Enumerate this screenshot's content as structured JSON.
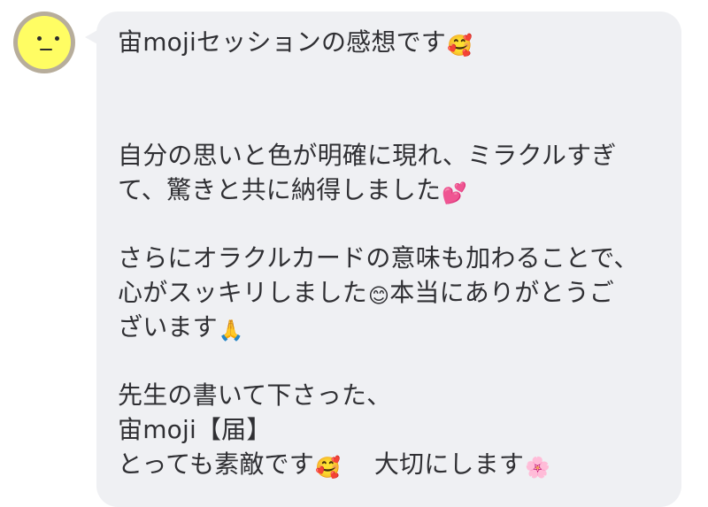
{
  "message": {
    "title": "宙mojiセッションの感想です",
    "title_emoji": "🥰",
    "paragraph1_line1": "自分の思いと色が明確に現れ、ミラクルすぎ",
    "paragraph1_line2": "て、驚きと共に納得しました",
    "paragraph1_emoji": "💕",
    "paragraph2_line1": "さらにオラクルカードの意味も加わることで、",
    "paragraph2_line2a": "心がスッキリしました",
    "paragraph2_emoji": "😊",
    "paragraph2_line2b": "本当にありがとうご",
    "paragraph2_line3": "ざいます",
    "paragraph2_emoji2": "🙏",
    "paragraph3_line1": "先生の書いて下さった、",
    "paragraph3_line2": "宙moji【届】",
    "paragraph3_line3a": "とっても素敵です",
    "paragraph3_emoji": "🥰",
    "paragraph3_line3b": "大切にします",
    "paragraph3_emoji2": "🌸"
  },
  "icons": {
    "avatar": "neutral-face-icon"
  },
  "colors": {
    "bubble": "#eff0f3",
    "text": "#2f2f33",
    "avatar_face": "#fffd63",
    "avatar_ring": "#b7ad9b"
  }
}
